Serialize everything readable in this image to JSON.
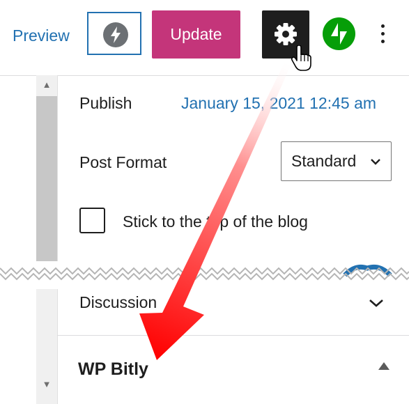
{
  "toolbar": {
    "preview_label": "Preview",
    "update_label": "Update",
    "icons": [
      "lightning-icon",
      "gear-icon",
      "jetpack-icon",
      "more-vertical-icon",
      "hand-pointer-cursor-icon"
    ]
  },
  "settings": {
    "publish_label": "Publish",
    "publish_date": "January 15, 2021 12:45 am",
    "post_format_label": "Post Format",
    "post_format_value": "Standard",
    "sticky_label": "Stick to the top of the blog",
    "sticky_checked": false
  },
  "panels": {
    "discussion_label": "Discussion",
    "wp_bitly_label": "WP Bitly"
  },
  "colors": {
    "accent_blue": "#2271b1",
    "update_pink": "#c4357a",
    "jetpack_green": "#069e08",
    "annotation_red": "#ff0000"
  }
}
